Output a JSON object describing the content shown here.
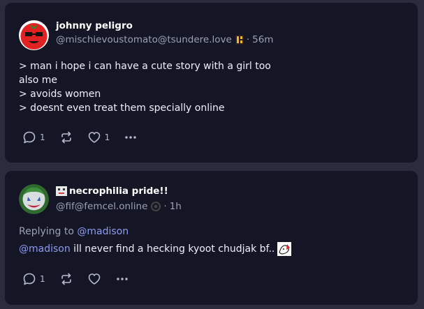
{
  "posts": [
    {
      "author_name": "johnny peligro",
      "handle": "@mischievoustomato@tsundere.love",
      "separator": "·",
      "time": "56m",
      "avatar_icon": "tomato-avatar",
      "lines": [
        "> man i hope i can have a cute story with a girl too",
        "also me",
        "> avoids women",
        "> doesnt even treat them specially online"
      ],
      "reply_count": "1",
      "like_count": "1"
    },
    {
      "author_name": "necrophilia pride!!",
      "handle": "@fif@femcel.online",
      "separator": "·",
      "time": "1h",
      "avatar_icon": "clown-avatar",
      "replying_label": "Replying to",
      "replying_mention": "@madison",
      "body_mention": "@madison",
      "body_text": " ill never find a hecking kyoot chudjak bf..",
      "reply_count": "1"
    }
  ],
  "colors": {
    "background": "#2a2c3d",
    "card": "#141625",
    "mention": "#8c9cf0",
    "muted": "#9ca0b5"
  }
}
